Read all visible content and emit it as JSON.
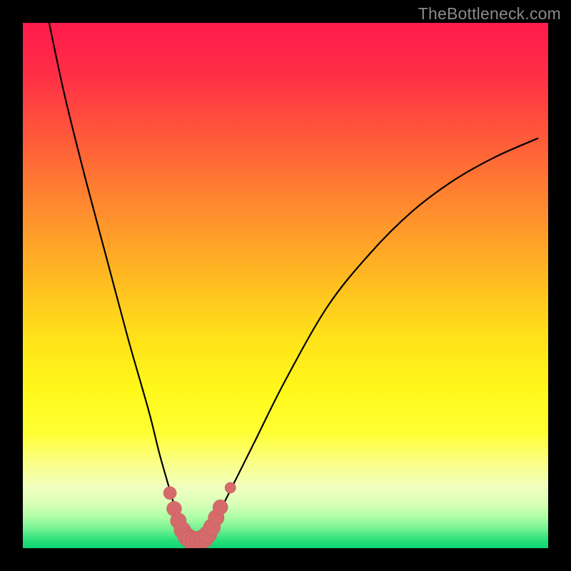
{
  "watermark": "TheBottleneck.com",
  "colors": {
    "frame": "#000000",
    "curve_stroke": "#000000",
    "marker_fill": "#d46a6a",
    "marker_stroke": "#c85a5a",
    "gradient_stops": [
      {
        "offset": 0.0,
        "color": "#ff1a4b"
      },
      {
        "offset": 0.1,
        "color": "#ff2f46"
      },
      {
        "offset": 0.22,
        "color": "#ff5a3a"
      },
      {
        "offset": 0.35,
        "color": "#ff8a2f"
      },
      {
        "offset": 0.48,
        "color": "#ffb822"
      },
      {
        "offset": 0.6,
        "color": "#ffe21a"
      },
      {
        "offset": 0.7,
        "color": "#fff81a"
      },
      {
        "offset": 0.78,
        "color": "#ffff33"
      },
      {
        "offset": 0.84,
        "color": "#faff8a"
      },
      {
        "offset": 0.885,
        "color": "#f0ffc0"
      },
      {
        "offset": 0.915,
        "color": "#d8ffb8"
      },
      {
        "offset": 0.94,
        "color": "#b0ffa8"
      },
      {
        "offset": 0.965,
        "color": "#70f090"
      },
      {
        "offset": 0.985,
        "color": "#28e07a"
      },
      {
        "offset": 1.0,
        "color": "#0fd373"
      }
    ]
  },
  "chart_data": {
    "type": "line",
    "title": "",
    "xlabel": "",
    "ylabel": "",
    "xlim": [
      0,
      100
    ],
    "ylim": [
      0,
      100
    ],
    "series": [
      {
        "name": "bottleneck-curve",
        "x": [
          5,
          8,
          12,
          16,
          20,
          24,
          26,
          28,
          29.5,
          31,
          32.5,
          34,
          35.5,
          37,
          40,
          44,
          50,
          58,
          66,
          74,
          82,
          90,
          98
        ],
        "y": [
          100,
          86,
          70,
          55,
          40,
          26,
          18,
          11,
          6,
          3,
          1.5,
          1.5,
          3,
          6,
          12,
          20,
          32,
          46,
          56,
          64,
          70,
          74.5,
          78
        ]
      }
    ],
    "markers": {
      "name": "highlighted-points",
      "points": [
        {
          "x": 28.0,
          "y": 10.5,
          "r": 1.3
        },
        {
          "x": 28.8,
          "y": 7.5,
          "r": 1.5
        },
        {
          "x": 29.6,
          "y": 5.2,
          "r": 1.6
        },
        {
          "x": 30.4,
          "y": 3.4,
          "r": 1.7
        },
        {
          "x": 31.2,
          "y": 2.2,
          "r": 1.8
        },
        {
          "x": 32.0,
          "y": 1.6,
          "r": 1.9
        },
        {
          "x": 32.8,
          "y": 1.4,
          "r": 1.9
        },
        {
          "x": 33.6,
          "y": 1.4,
          "r": 1.9
        },
        {
          "x": 34.4,
          "y": 1.8,
          "r": 1.9
        },
        {
          "x": 35.2,
          "y": 2.6,
          "r": 1.8
        },
        {
          "x": 36.0,
          "y": 4.0,
          "r": 1.7
        },
        {
          "x": 36.8,
          "y": 5.8,
          "r": 1.6
        },
        {
          "x": 37.6,
          "y": 7.8,
          "r": 1.5
        },
        {
          "x": 39.5,
          "y": 11.5,
          "r": 1.1
        }
      ]
    }
  }
}
